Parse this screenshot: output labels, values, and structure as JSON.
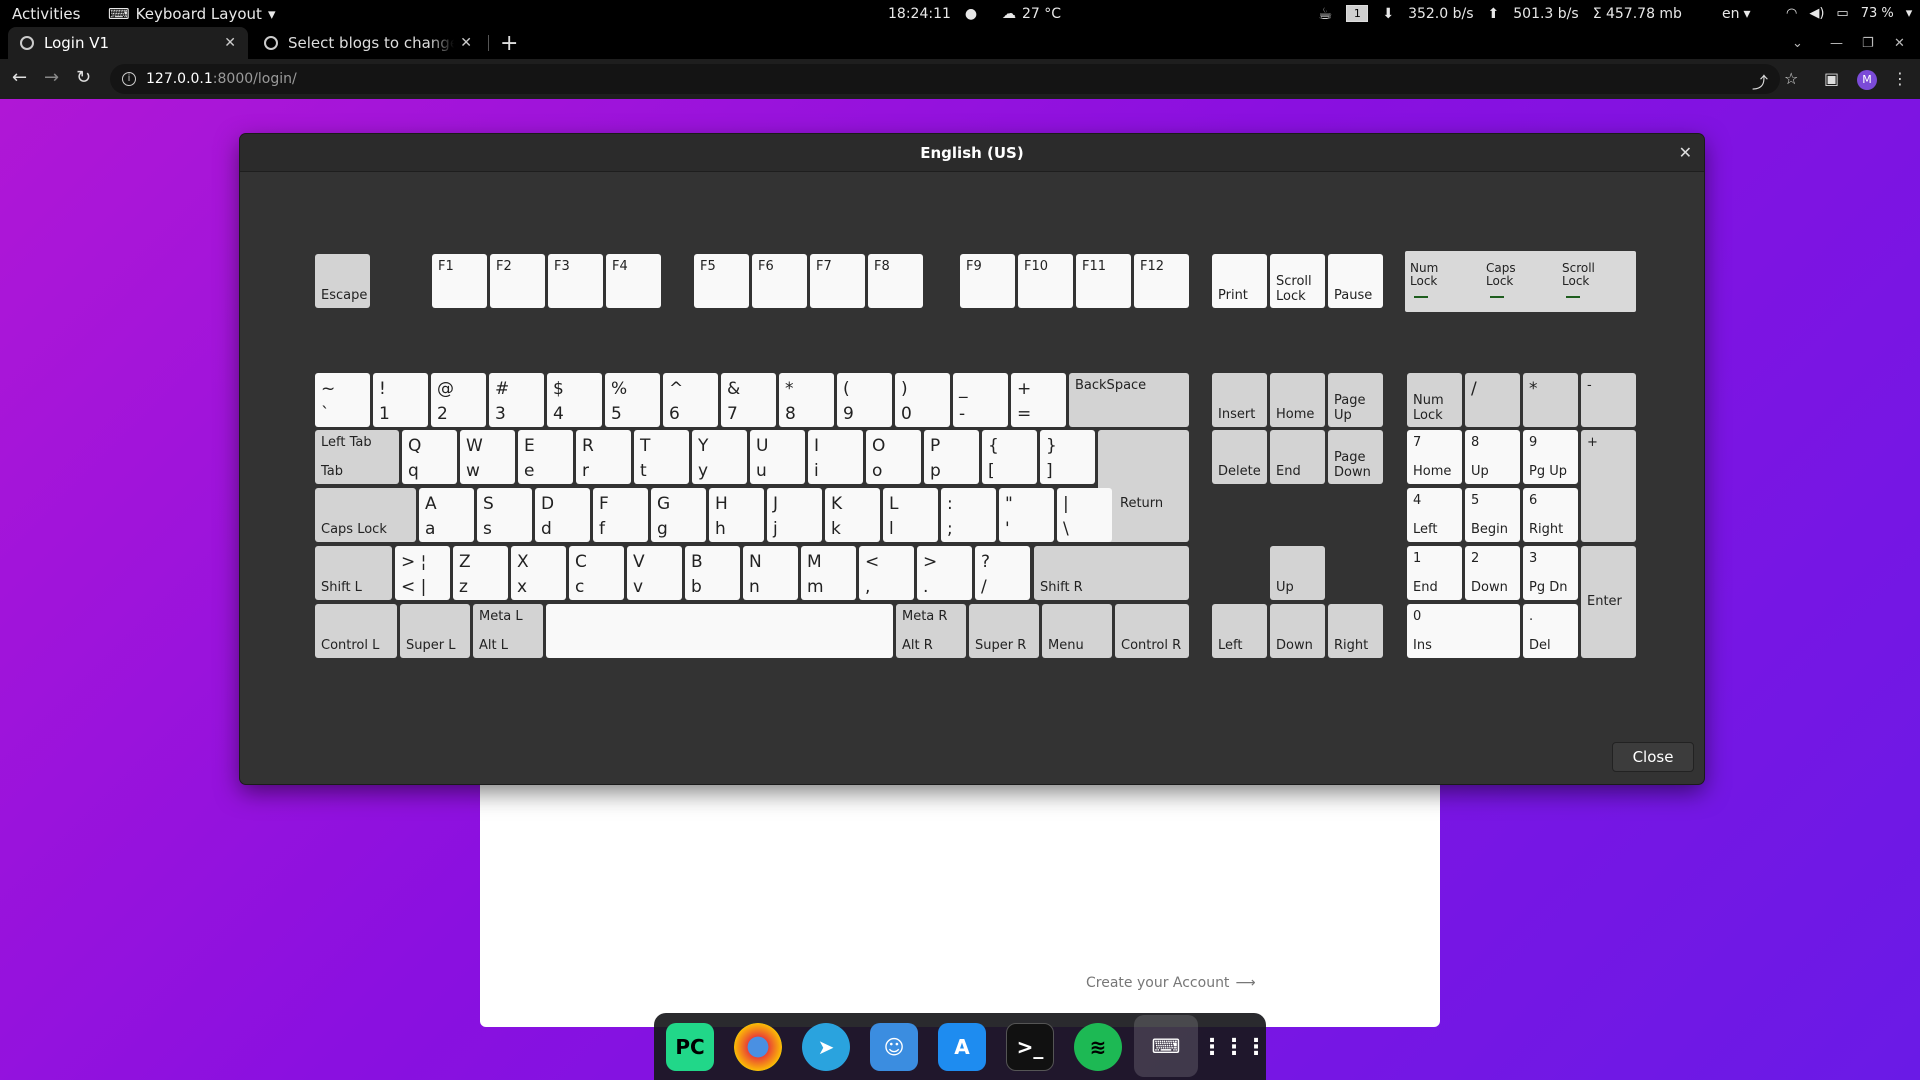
{
  "topbar": {
    "activities": "Activities",
    "keyboard_layout": "Keyboard Layout",
    "time": "18:24:11",
    "weather": "27 °C",
    "workspace": "1",
    "net_down": "352.0 b/s",
    "net_up": "501.3 b/s",
    "mem": "Σ  457.78 mb",
    "lang": "en",
    "battery": "73 %"
  },
  "browser": {
    "tabs": [
      {
        "title": "Login V1"
      },
      {
        "title": "Select blogs to change | Django"
      }
    ],
    "url_host": "127.0.0.1",
    "url_rest": ":8000/login/",
    "profile_initial": "M"
  },
  "page": {
    "create_account": "Create your Account"
  },
  "dialog": {
    "title": "English (US)",
    "close_button": "Close",
    "leds": [
      "Num\nLock",
      "Caps\nLock",
      "Scroll\nLock"
    ]
  }
}
